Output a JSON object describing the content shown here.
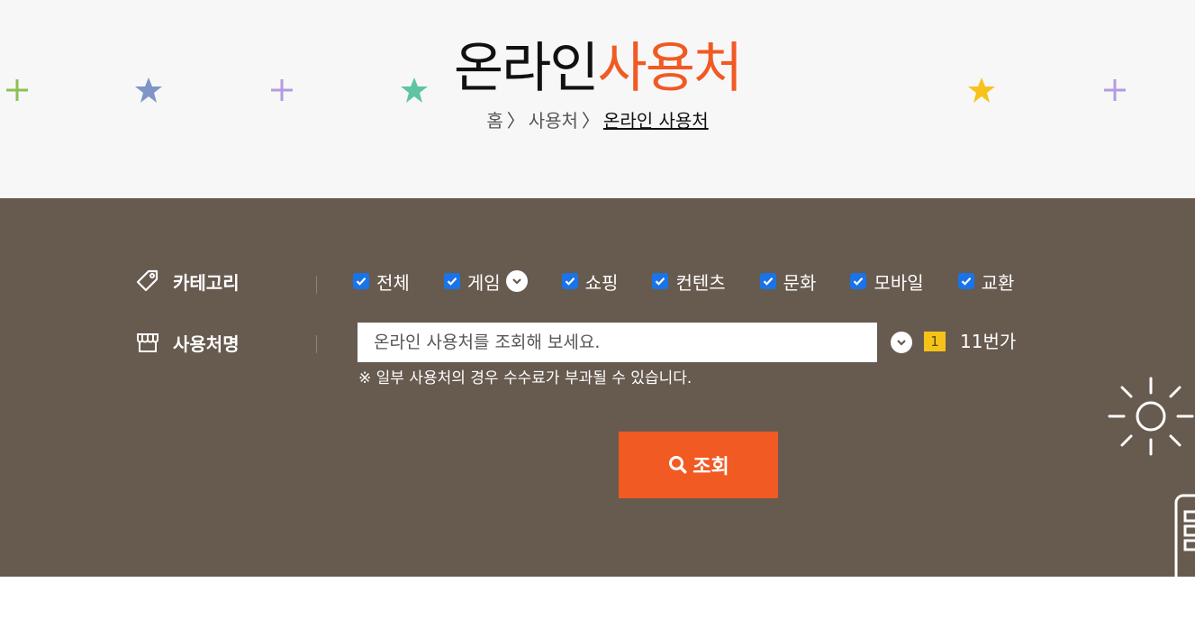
{
  "header": {
    "title_main": "온라인",
    "title_accent": "사용처",
    "breadcrumb": {
      "home": "홈",
      "parent": "사용처",
      "current": "온라인 사용처"
    }
  },
  "colors": {
    "accent": "#f05a23",
    "panel_bg": "#675a4f",
    "header_bg": "#f7f7f7",
    "checkbox": "#1a73e8",
    "rank_badge": "#f6c21a",
    "button": "#f15a22"
  },
  "filters": {
    "category_label": "카테고리",
    "categories": [
      {
        "label": "전체",
        "checked": true
      },
      {
        "label": "게임",
        "checked": true
      },
      {
        "label": "쇼핑",
        "checked": true
      },
      {
        "label": "컨텐츠",
        "checked": true
      },
      {
        "label": "문화",
        "checked": true
      },
      {
        "label": "모바일",
        "checked": true
      },
      {
        "label": "교환",
        "checked": true
      }
    ],
    "name_label": "사용처명",
    "search_placeholder": "온라인 사용처를 조회해 보세요.",
    "search_value": "",
    "rank_number": "1",
    "rank_text": "11번가",
    "notice": "※ 일부 사용처의 경우 수수료가 부과될 수 있습니다.",
    "submit_label": "조회"
  },
  "icons": {
    "category": "tag-icon",
    "name": "store-icon",
    "submit": "search-icon"
  }
}
